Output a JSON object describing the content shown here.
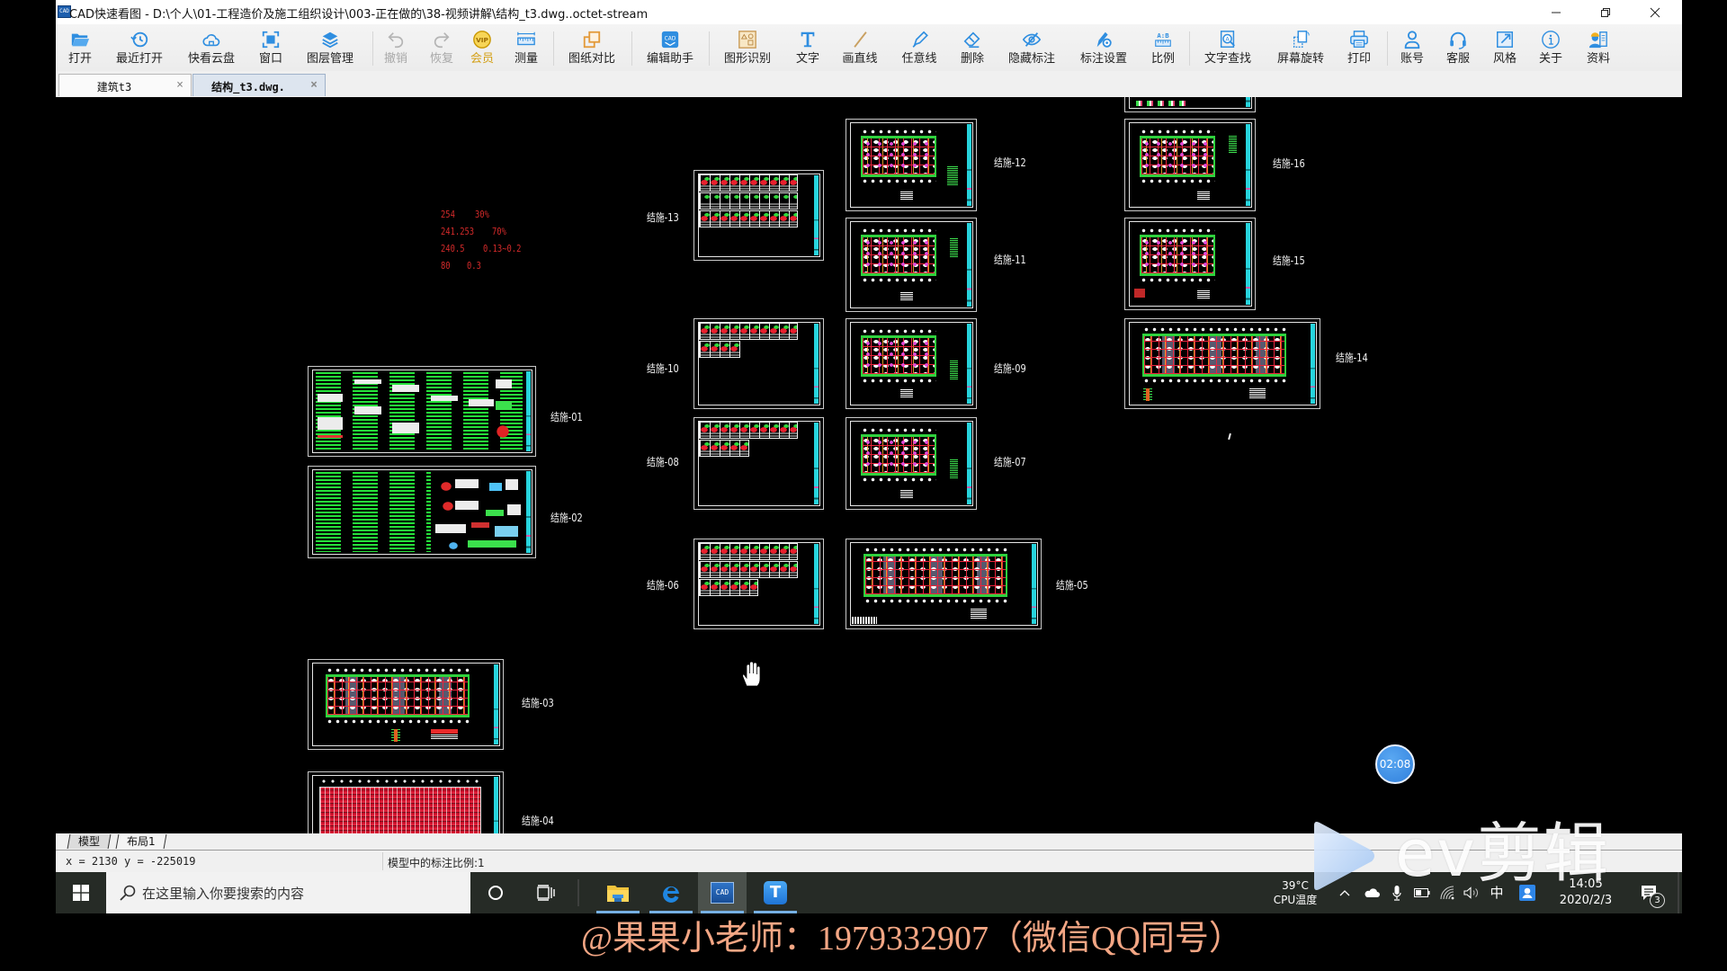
{
  "window": {
    "title": "CAD快速看图 - D:\\个人\\01-工程造价及施工组织设计\\003-正在做的\\38-视频讲解\\结构_t3.dwg..octet-stream",
    "app_icon_glyph": "CAD"
  },
  "toolbar": {
    "items": [
      {
        "label": "打开",
        "icon": "folder-open-icon"
      },
      {
        "label": "最近打开",
        "icon": "history-icon"
      },
      {
        "label": "快看云盘",
        "icon": "cloud-icon"
      },
      {
        "label": "窗口",
        "icon": "window-icon"
      },
      {
        "label": "图层管理",
        "icon": "layers-icon"
      },
      {
        "label": "撤销",
        "icon": "undo-icon",
        "disabled": true
      },
      {
        "label": "恢复",
        "icon": "redo-icon",
        "disabled": true
      },
      {
        "label": "会员",
        "icon": "vip-icon"
      },
      {
        "label": "测量",
        "icon": "ruler-icon"
      },
      {
        "label": "图纸对比",
        "icon": "compare-icon"
      },
      {
        "label": "编辑助手",
        "icon": "cad-edit-icon"
      },
      {
        "label": "图形识别",
        "icon": "shape-recognize-icon"
      },
      {
        "label": "文字",
        "icon": "text-icon"
      },
      {
        "label": "画直线",
        "icon": "line-icon"
      },
      {
        "label": "任意线",
        "icon": "pen-icon"
      },
      {
        "label": "删除",
        "icon": "eraser-icon"
      },
      {
        "label": "隐藏标注",
        "icon": "eye-slash-icon"
      },
      {
        "label": "标注设置",
        "icon": "annotation-settings-icon"
      },
      {
        "label": "比例",
        "icon": "scale-icon"
      },
      {
        "label": "文字查找",
        "icon": "text-search-icon"
      },
      {
        "label": "屏幕旋转",
        "icon": "rotate-screen-icon"
      },
      {
        "label": "打印",
        "icon": "printer-icon"
      },
      {
        "label": "账号",
        "icon": "user-icon"
      },
      {
        "label": "客服",
        "icon": "headset-icon"
      },
      {
        "label": "风格",
        "icon": "style-icon"
      },
      {
        "label": "关于",
        "icon": "info-icon"
      },
      {
        "label": "资料",
        "icon": "resources-icon"
      }
    ],
    "vip_glyph": "VIP",
    "scale_glyph": "A:B",
    "cad_glyph": "CAD",
    "search_glyph": "A"
  },
  "tabs": {
    "items": [
      {
        "label": "建筑t3",
        "active": false
      },
      {
        "label": "结构_t3.dwg.",
        "active": true
      }
    ],
    "close_glyph": "×"
  },
  "canvas": {
    "annotation": [
      {
        "value": "254",
        "ratio": "30%"
      },
      {
        "value": "241.253",
        "ratio": "70%"
      },
      {
        "value": "240.5",
        "ratio": "0.13~0.2"
      },
      {
        "value": "80",
        "ratio": "0.3"
      }
    ],
    "sheets": [
      {
        "label": "结施-01"
      },
      {
        "label": "结施-02"
      },
      {
        "label": "结施-03"
      },
      {
        "label": "结施-04"
      },
      {
        "label": "结施-05"
      },
      {
        "label": "结施-06"
      },
      {
        "label": "结施-07"
      },
      {
        "label": "结施-08"
      },
      {
        "label": "结施-09"
      },
      {
        "label": "结施-10"
      },
      {
        "label": "结施-11"
      },
      {
        "label": "结施-12"
      },
      {
        "label": "结施-13"
      },
      {
        "label": "结施-14"
      },
      {
        "label": "结施-15"
      },
      {
        "label": "结施-16"
      }
    ]
  },
  "layout_tabs": [
    "模型",
    "布局1"
  ],
  "status": {
    "coords": "x = 2130 y = -225019",
    "scale_text": "模型中的标注比例:1"
  },
  "taskbar": {
    "search_placeholder": "在这里输入你要搜索的内容",
    "apps": [
      "file-explorer",
      "edge",
      "cad-viewer",
      "t-app"
    ],
    "cad_glyph": "CAD",
    "t_glyph": "T",
    "cpu_temp": "39°C",
    "cpu_label": "CPU温度",
    "ime": "中",
    "time": "14:05",
    "date": "2020/2/3",
    "notifications": "3"
  },
  "overlay": {
    "timer": "02:08",
    "watermark": "ev剪辑",
    "caption": "@果果小老师：1979332907（微信QQ同号）"
  },
  "colors": {
    "accent": "#2f8ee0",
    "vip": "#d4a017",
    "annotation_red": "#d42a2a",
    "caption": "#f3a684",
    "canvas": "#000000",
    "taskbar": "#262b26"
  }
}
